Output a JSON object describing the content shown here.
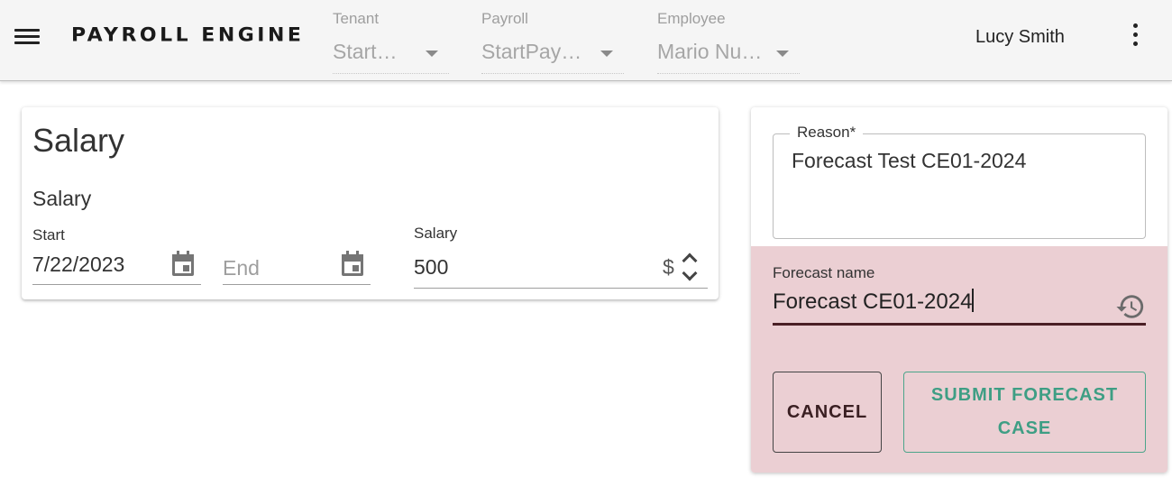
{
  "colors": {
    "accent_primary": "#4a1f25",
    "accent_secondary": "#3e9e84",
    "panel_bg": "#ebcfd3",
    "appbar_bg": "#f5f5f5"
  },
  "appbar": {
    "menu_icon": "hamburger-menu-icon",
    "brand": "PAYROLL ENGINE",
    "selectors": [
      {
        "label": "Tenant",
        "value": "StartTenant"
      },
      {
        "label": "Payroll",
        "value": "StartPayroll"
      },
      {
        "label": "Employee",
        "value": "Mario Nuñez"
      }
    ],
    "user_name": "Lucy Smith",
    "more_icon": "more-vert-icon"
  },
  "salary_card": {
    "title": "Salary",
    "subtitle": "Salary",
    "start": {
      "label": "Start",
      "value": "7/22/2023",
      "icon": "calendar-icon"
    },
    "end": {
      "placeholder": "End",
      "icon": "calendar-icon"
    },
    "salary": {
      "label": "Salary",
      "value": "500",
      "currency": "$"
    }
  },
  "forecast_panel": {
    "reason": {
      "label": "Reason*",
      "value": "Forecast Test CE01-2024"
    },
    "forecast_name": {
      "label": "Forecast name",
      "value": "Forecast CE01-2024",
      "icon": "history-icon"
    },
    "cancel_label": "CANCEL",
    "submit_label": "SUBMIT FORECAST CASE"
  }
}
